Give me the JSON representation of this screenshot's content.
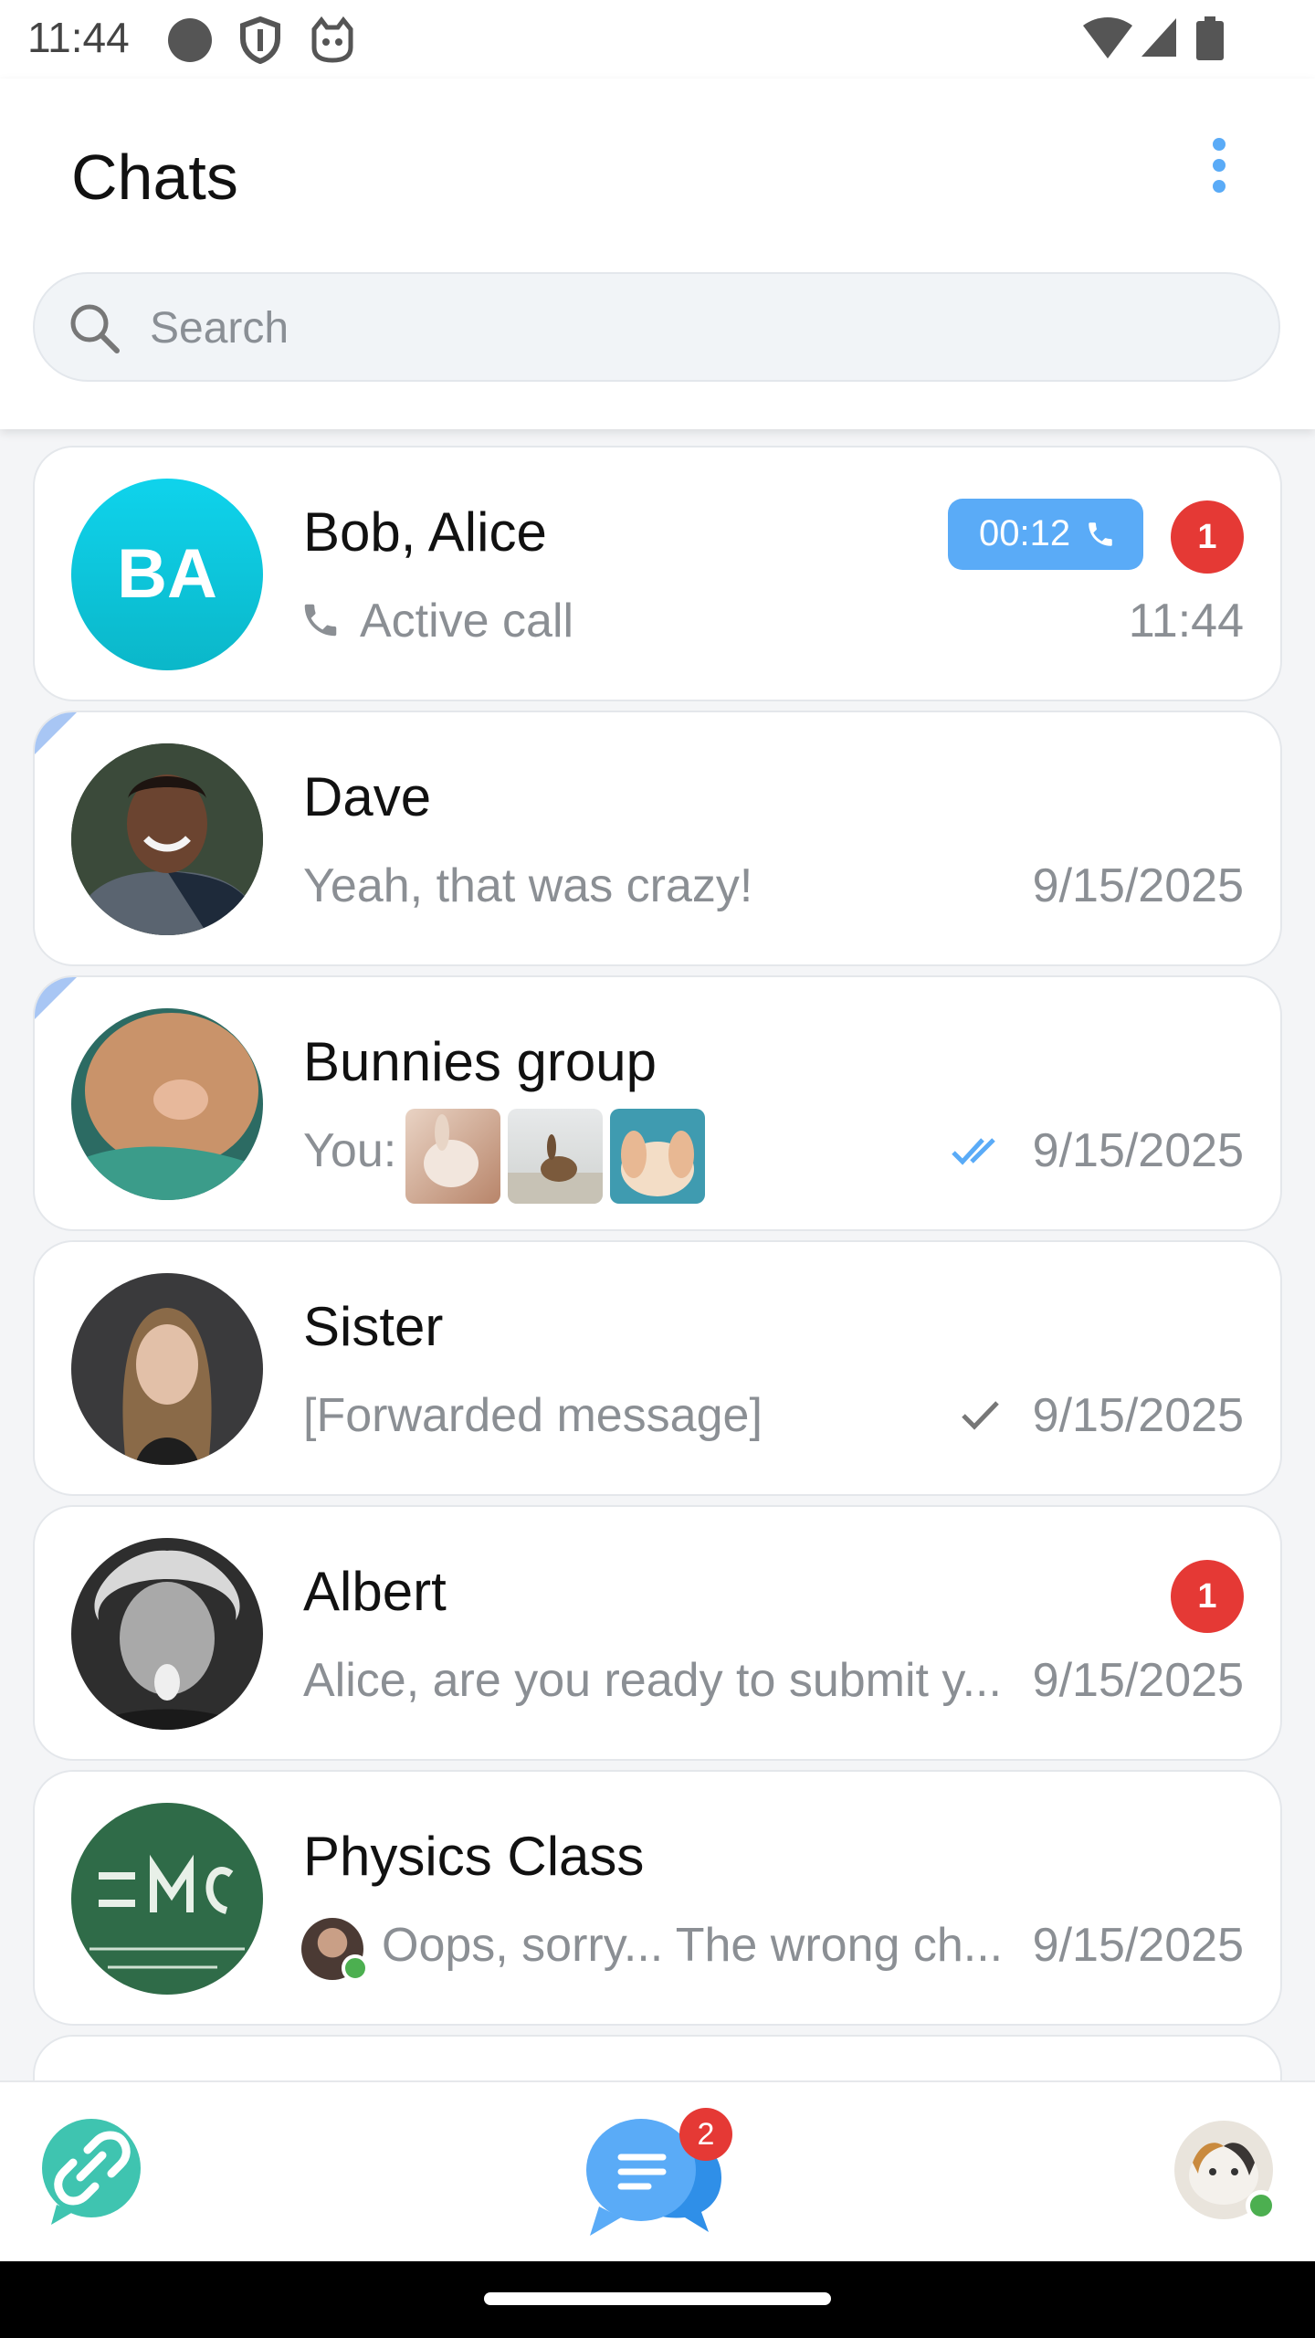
{
  "status_bar": {
    "time": "11:44",
    "left_icons": [
      "circle-icon",
      "shield-icon",
      "cat-icon"
    ],
    "right_icons": [
      "wifi-icon",
      "signal-icon",
      "battery-icon"
    ]
  },
  "header": {
    "title": "Chats",
    "menu_icon": "more-vertical-icon",
    "search_placeholder": "Search"
  },
  "chats": [
    {
      "name": "Bob, Alice",
      "avatar_initials": "BA",
      "preview": "Active call",
      "preview_icon": "phone-icon",
      "time": "11:44",
      "call_duration": "00:12",
      "unread": "1"
    },
    {
      "name": "Dave",
      "preview": "Yeah, that was crazy!",
      "time": "9/15/2025",
      "pinned_flag": true
    },
    {
      "name": "Bunnies group",
      "preview": "You:",
      "time": "9/15/2025",
      "status_icon": "double-check-icon",
      "pinned_flag": true,
      "thumbnails": [
        "bunny-photo-1",
        "bunny-photo-2",
        "bunny-photo-3"
      ]
    },
    {
      "name": "Sister",
      "preview": "[Forwarded message]",
      "time": "9/15/2025",
      "status_icon": "check-icon"
    },
    {
      "name": "Albert",
      "preview": "Alice, are you ready to submit y...",
      "time": "9/15/2025",
      "unread": "1"
    },
    {
      "name": "Physics Class",
      "preview": "Oops, sorry... The wrong ch...",
      "time": "9/15/2025"
    }
  ],
  "bottom_nav": {
    "left_icon": "link-icon",
    "center_icon": "chats-icon",
    "center_badge": "2",
    "right_icon": "profile-avatar"
  },
  "colors": {
    "accent": "#5aabf7",
    "badge": "#e53935",
    "online": "#4caf50",
    "link_button": "#3fc4b0",
    "avatar_ba": "#12c6dc"
  }
}
